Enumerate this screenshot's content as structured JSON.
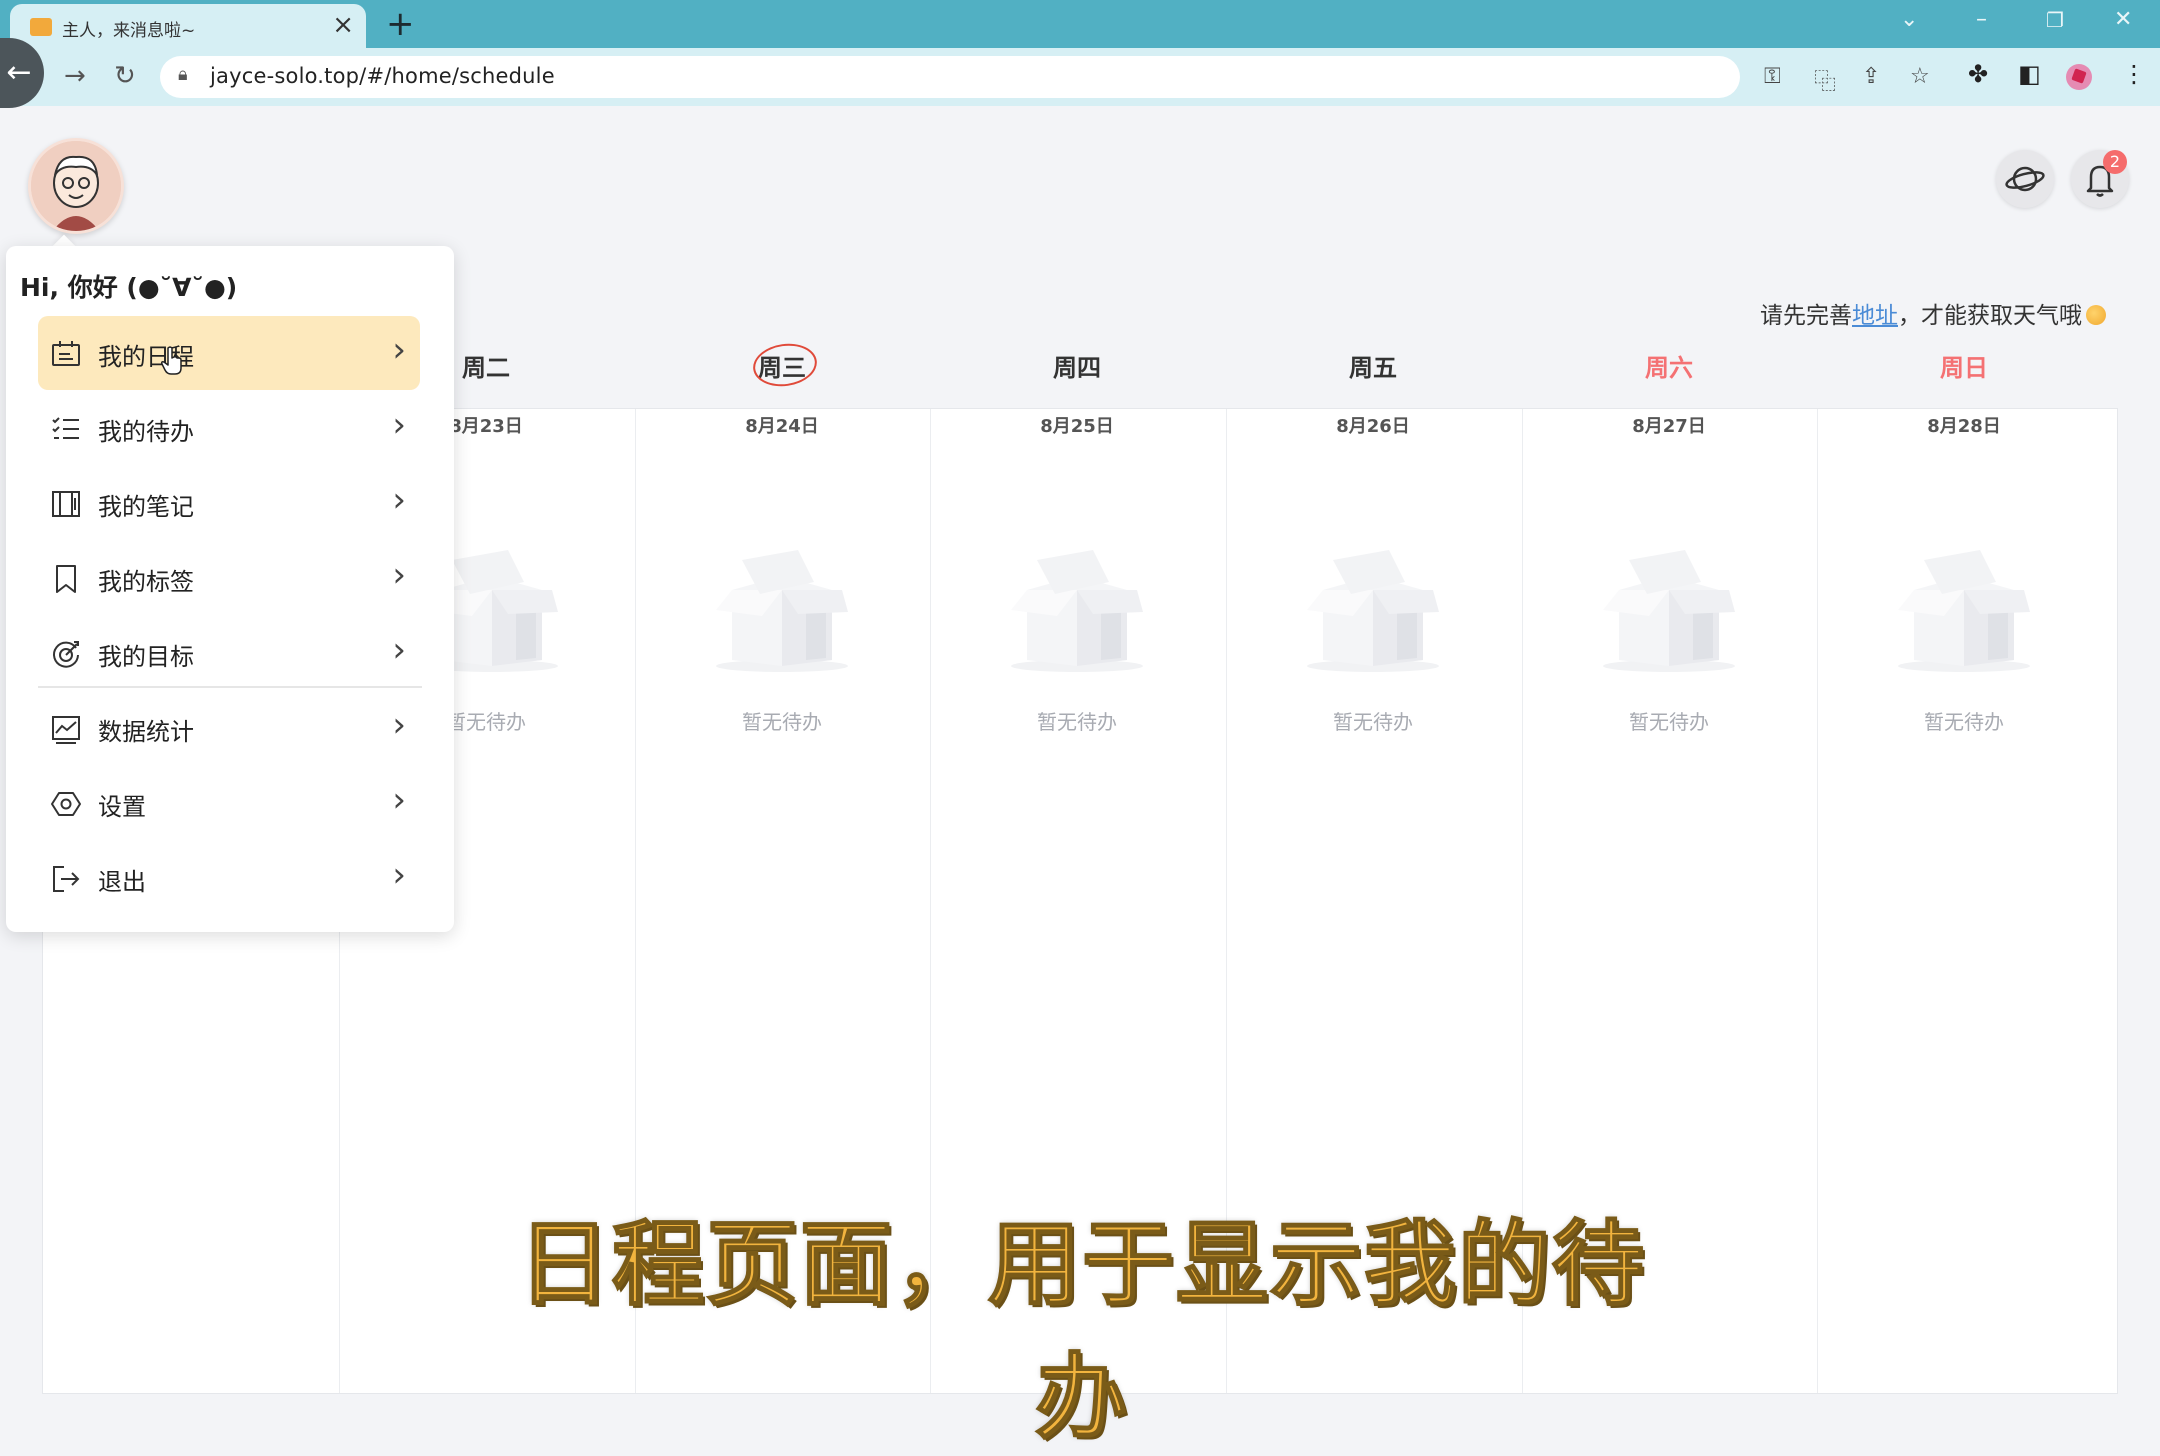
{
  "browser": {
    "tab_title": "主人，来消息啦~",
    "url": "jayce-solo.top/#/home/schedule"
  },
  "header": {
    "weather_prefix": "请先完善",
    "weather_link": "地址",
    "weather_suffix": "，才能获取天气哦",
    "notification_count": "2"
  },
  "menu": {
    "greeting": "Hi, 你好 (●˘∀˘●)",
    "items": [
      {
        "label": "我的日程",
        "icon": "schedule-icon"
      },
      {
        "label": "我的待办",
        "icon": "todo-list-icon"
      },
      {
        "label": "我的笔记",
        "icon": "notes-icon"
      },
      {
        "label": "我的标签",
        "icon": "bookmark-icon"
      },
      {
        "label": "我的目标",
        "icon": "target-icon"
      },
      {
        "label": "数据统计",
        "icon": "chart-icon"
      },
      {
        "label": "设置",
        "icon": "settings-icon"
      },
      {
        "label": "退出",
        "icon": "logout-icon"
      }
    ]
  },
  "week": {
    "days": [
      {
        "name": "周二",
        "date": "8月23日"
      },
      {
        "name": "周三",
        "date": "8月24日"
      },
      {
        "name": "周四",
        "date": "8月25日"
      },
      {
        "name": "周五",
        "date": "8月26日"
      },
      {
        "name": "周六",
        "date": "8月27日"
      },
      {
        "name": "周日",
        "date": "8月28日"
      }
    ],
    "empty_text": "暂无待办",
    "empty_text_partial": "暂无待办"
  },
  "subtitle": "日程页面，用于显示我的待办",
  "colors": {
    "tabbar": "#51b0c3",
    "menu_active": "#fde9bd",
    "weekend": "#f47173",
    "subtitle": "#f2b43e"
  }
}
